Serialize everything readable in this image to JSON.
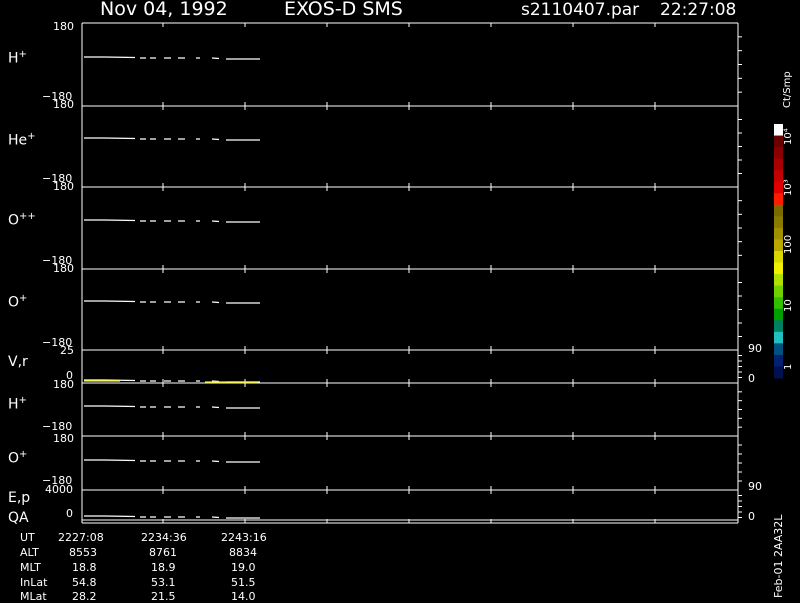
{
  "header": {
    "date": "Nov 04, 1992",
    "instrument": "EXOS-D SMS",
    "file": "s2110407.par",
    "time": "22:27:08"
  },
  "colors": {
    "background": "#000000",
    "axis": "#ffffff",
    "data_trace": "#ffffff"
  },
  "panels": [
    {
      "label": "H",
      "charge": "+",
      "ytop": "180",
      "ybottom": "−180"
    },
    {
      "label": "He",
      "charge": "+",
      "ytop": "180",
      "ybottom": "−180"
    },
    {
      "label": "O",
      "charge": "++",
      "ytop": "180",
      "ybottom": "−180"
    },
    {
      "label": "O",
      "charge": "+",
      "ytop": "180",
      "ybottom": "−180"
    },
    {
      "label": "V,r",
      "charge": "",
      "ytop": "25",
      "ybottom": "0",
      "rtop": "90",
      "rbottom": "0"
    },
    {
      "label": "H",
      "charge": "+",
      "ytop": "180",
      "ybottom": "−180"
    },
    {
      "label": "O",
      "charge": "+",
      "ytop": "180",
      "ybottom": "−180"
    },
    {
      "label": "E,p",
      "label2": "QA",
      "charge": "",
      "ytop": "4000",
      "ybottom": "0",
      "rtop": "90",
      "rbottom": "0"
    }
  ],
  "colorbar": {
    "title": "Ct/Smp",
    "labels": [
      "10⁴",
      "10³",
      "100",
      "10",
      "1"
    ],
    "colors": [
      "#ffffff",
      "#6b0000",
      "#8a0000",
      "#a80000",
      "#c40000",
      "#e00000",
      "#ff1a00",
      "#7a6a00",
      "#8a7a00",
      "#a09000",
      "#b8a800",
      "#d8d800",
      "#f0f000",
      "#b0e000",
      "#70d000",
      "#30c000",
      "#00a000",
      "#008060",
      "#20c0c0",
      "#005080",
      "#002070",
      "#001050"
    ]
  },
  "ephemeris": {
    "row_labels": [
      "UT",
      "ALT",
      "MLT",
      "InLat",
      "MLat"
    ],
    "columns": [
      [
        "2227:08",
        "8553",
        "18.8",
        "54.8",
        "28.2"
      ],
      [
        "2234:36",
        "8761",
        "18.9",
        "53.1",
        "21.5"
      ],
      [
        "2243:16",
        "8834",
        "19.0",
        "51.5",
        "14.0"
      ]
    ]
  },
  "footer_id": "Feb-01 2AA32L",
  "chart_data": {
    "type": "line",
    "title": "Nov 04, 1992   EXOS-D SMS",
    "x": [
      "2227:08",
      "2234:36",
      "2243:16"
    ],
    "series": [
      {
        "name": "H+",
        "ylim": [
          -180,
          180
        ]
      },
      {
        "name": "He+",
        "ylim": [
          -180,
          180
        ]
      },
      {
        "name": "O++",
        "ylim": [
          -180,
          180
        ]
      },
      {
        "name": "O+",
        "ylim": [
          -180,
          180
        ]
      },
      {
        "name": "V,r",
        "ylim": [
          0,
          25
        ]
      },
      {
        "name": "H+",
        "ylim": [
          -180,
          180
        ]
      },
      {
        "name": "O+",
        "ylim": [
          -180,
          180
        ]
      },
      {
        "name": "E,p",
        "ylim": [
          0,
          4000
        ]
      }
    ]
  }
}
